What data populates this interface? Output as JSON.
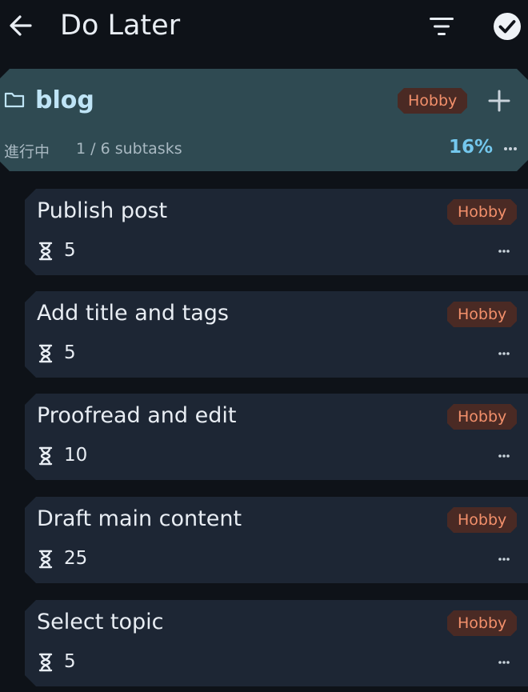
{
  "header": {
    "title": "Do Later"
  },
  "project": {
    "name": "blog",
    "tag": "Hobby",
    "status": "進行中",
    "subtasks": "1 / 6 subtasks",
    "progress": "16%"
  },
  "tasks": [
    {
      "title": "Publish post",
      "tag": "Hobby",
      "duration": "5"
    },
    {
      "title": "Add title and tags",
      "tag": "Hobby",
      "duration": "5"
    },
    {
      "title": "Proofread and edit",
      "tag": "Hobby",
      "duration": "10"
    },
    {
      "title": "Draft main content",
      "tag": "Hobby",
      "duration": "25"
    },
    {
      "title": "Select topic",
      "tag": "Hobby",
      "duration": "5"
    }
  ],
  "icons": {
    "back": "arrow-left-icon",
    "filter": "filter-icon",
    "done": "check-circle-icon",
    "folder": "folder-icon",
    "add": "plus-icon",
    "more": "more-horizontal-icon",
    "duration": "hourglass-icon"
  },
  "colors": {
    "background": "#0e1218",
    "project_card": "#2f4a52",
    "task_card": "#1d2634",
    "tag_bg": "#4a2a24",
    "tag_text": "#f3906b",
    "accent": "#74c8ee"
  }
}
